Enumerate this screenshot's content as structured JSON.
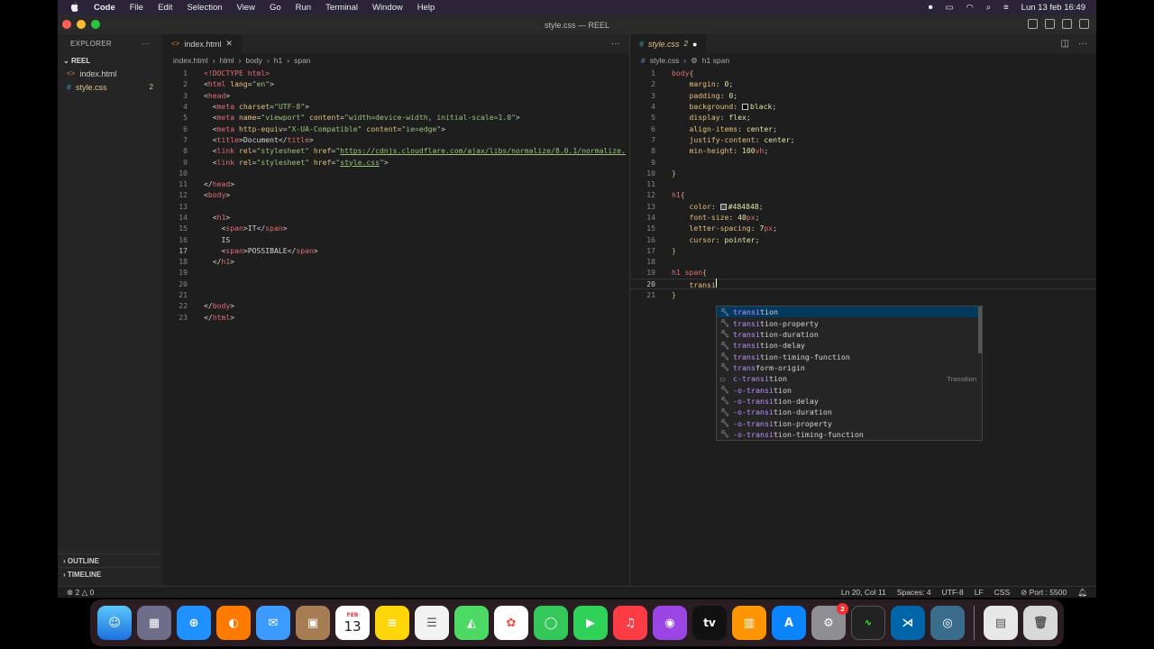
{
  "menubar": {
    "app": "Code",
    "items": [
      "File",
      "Edit",
      "Selection",
      "View",
      "Go",
      "Run",
      "Terminal",
      "Window",
      "Help"
    ],
    "datetime": "Lun 13 feb  16:49"
  },
  "window": {
    "title": "style.css — REEL"
  },
  "sidebar": {
    "header": "EXPLORER",
    "folder": "REEL",
    "files": [
      {
        "name": "index.html",
        "badge": ""
      },
      {
        "name": "style.css",
        "badge": "2"
      }
    ],
    "outline": "OUTLINE",
    "timeline": "TIMELINE"
  },
  "left_editor": {
    "tab": "index.html",
    "breadcrumb": [
      "index.html",
      "html",
      "body",
      "h1",
      "span"
    ],
    "line_numbers": [
      "1",
      "2",
      "3",
      "4",
      "5",
      "6",
      "7",
      "8",
      "9",
      "10",
      "11",
      "12",
      "13",
      "14",
      "15",
      "16",
      "17",
      "18",
      "19",
      "20",
      "21",
      "22",
      "23"
    ],
    "current_line": "17"
  },
  "right_editor": {
    "tab": "style.css",
    "tab_badge": "2",
    "breadcrumb": [
      "style.css",
      "h1 span"
    ],
    "line_numbers": [
      "1",
      "2",
      "3",
      "4",
      "5",
      "6",
      "7",
      "8",
      "9",
      "10",
      "11",
      "12",
      "13",
      "14",
      "15",
      "16",
      "17",
      "18",
      "19",
      "20",
      "21"
    ],
    "current_line": "20"
  },
  "html_code": {
    "doctype": "<!DOCTYPE html>",
    "link_url": "https://cdnjs.cloudflare.com/ajax/libs/normalize/8.0.1/normalize.",
    "title": "Document",
    "span1": "IT",
    "is": "IS",
    "span2": "POSSIBALE"
  },
  "suggest": {
    "items": [
      {
        "match": "transi",
        "rest": "tion",
        "icon": "wrench-icon",
        "detail": ""
      },
      {
        "match": "transi",
        "rest": "tion-property",
        "icon": "wrench-icon",
        "detail": ""
      },
      {
        "match": "transi",
        "rest": "tion-duration",
        "icon": "wrench-icon",
        "detail": ""
      },
      {
        "match": "transi",
        "rest": "tion-delay",
        "icon": "wrench-icon",
        "detail": ""
      },
      {
        "match": "transi",
        "rest": "tion-timing-function",
        "icon": "wrench-icon",
        "detail": ""
      },
      {
        "match": "trans",
        "rest": "form-origin",
        "icon": "wrench-icon",
        "detail": ""
      },
      {
        "match": "c-transi",
        "rest": "tion",
        "icon": "snippet-icon",
        "detail": "Transition"
      },
      {
        "match": "-o-transi",
        "rest": "tion",
        "icon": "wrench-icon",
        "detail": ""
      },
      {
        "match": "-o-transi",
        "rest": "tion-delay",
        "icon": "wrench-icon",
        "detail": ""
      },
      {
        "match": "-o-transi",
        "rest": "tion-duration",
        "icon": "wrench-icon",
        "detail": ""
      },
      {
        "match": "-o-transi",
        "rest": "tion-property",
        "icon": "wrench-icon",
        "detail": ""
      },
      {
        "match": "-o-transi",
        "rest": "tion-timing-function",
        "icon": "wrench-icon",
        "detail": ""
      }
    ]
  },
  "statusbar": {
    "problems": "2",
    "warnings": "0",
    "position": "Ln 20, Col 11",
    "spaces": "Spaces: 4",
    "encoding": "UTF-8",
    "eol": "LF",
    "language": "CSS",
    "port": "Port : 5500"
  },
  "dock": {
    "calendar_month": "FEB",
    "calendar_day": "13",
    "settings_badge": "2",
    "appletv": "tv"
  }
}
